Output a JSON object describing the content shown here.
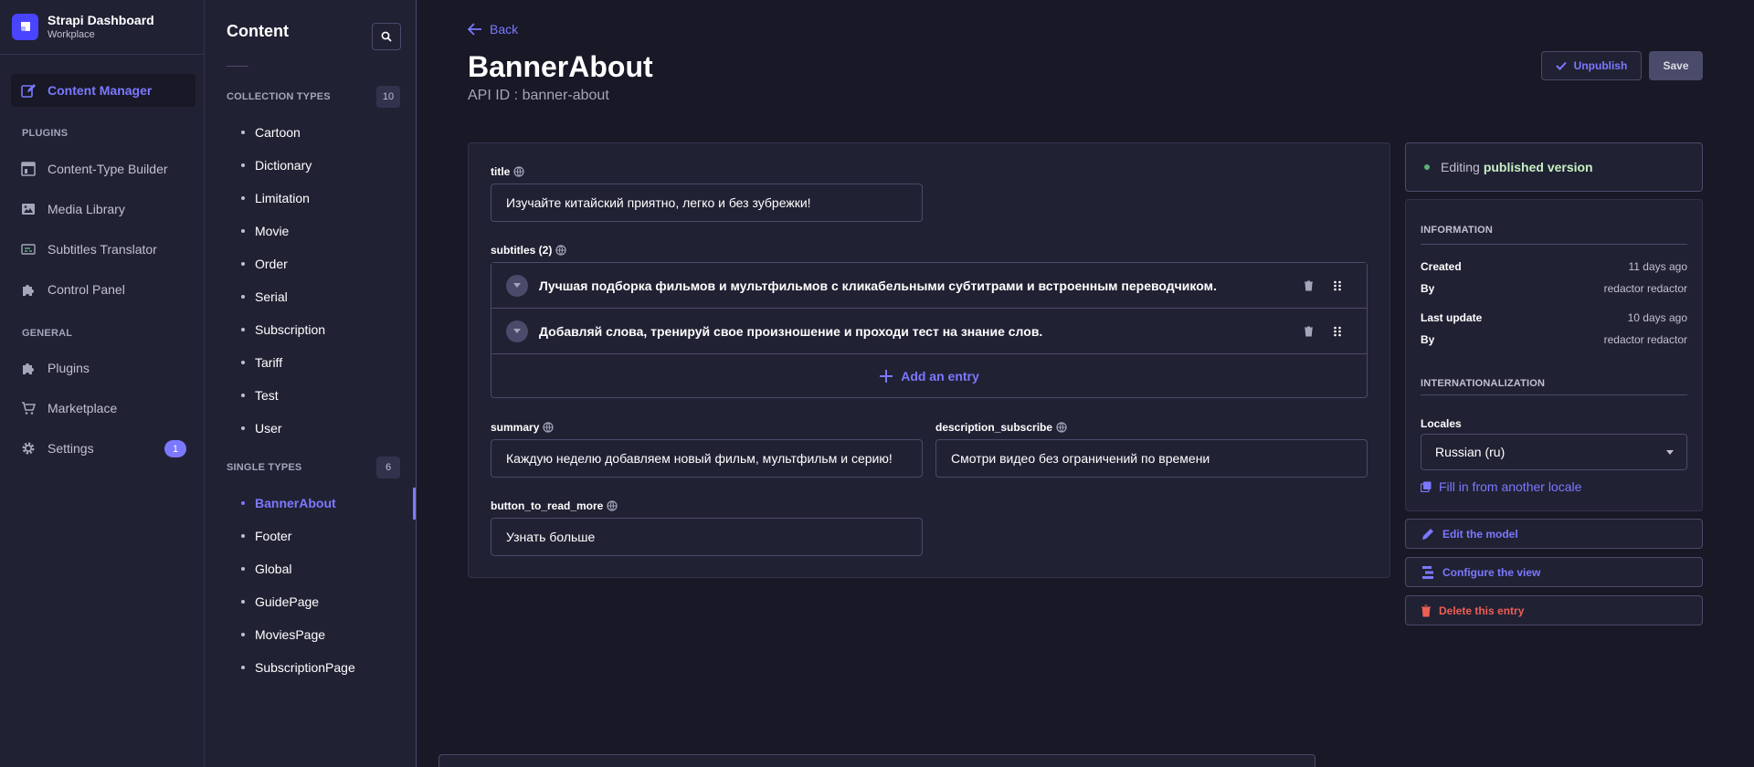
{
  "brand": {
    "title": "Strapi Dashboard",
    "subtitle": "Workplace"
  },
  "leftnav": {
    "active_item": "Content Manager",
    "section_plugins": "PLUGINS",
    "plugins": [
      "Content-Type Builder",
      "Media Library",
      "Subtitles Translator",
      "Control Panel"
    ],
    "section_general": "GENERAL",
    "general": [
      "Plugins",
      "Marketplace",
      "Settings"
    ],
    "settings_badge": "1"
  },
  "subnav": {
    "title": "Content",
    "collection_label": "COLLECTION TYPES",
    "collection_count": "10",
    "collection_types": [
      "Cartoon",
      "Dictionary",
      "Limitation",
      "Movie",
      "Order",
      "Serial",
      "Subscription",
      "Tariff",
      "Test",
      "User"
    ],
    "single_label": "SINGLE TYPES",
    "single_count": "6",
    "single_types": [
      "BannerAbout",
      "Footer",
      "Global",
      "GuidePage",
      "MoviesPage",
      "SubscriptionPage"
    ]
  },
  "header": {
    "back": "Back",
    "title": "BannerAbout",
    "api_id": "API ID : banner-about",
    "unpublish": "Unpublish",
    "save": "Save"
  },
  "form": {
    "title_label": "title",
    "title_value": "Изучайте китайский приятно, легко и без зубрежки!",
    "subtitles_label": "subtitles (2)",
    "subtitles": [
      "Лучшая подборка фильмов и мультфильмов с кликабельными субтитрами и встроенным переводчиком.",
      "Добавляй слова, тренируй свое произношение и проходи тест на знание слов."
    ],
    "add_entry": "Add an entry",
    "summary_label": "summary",
    "summary_value": "Каждую неделю добавляем новый фильм, мультфильм и серию!",
    "description_subscribe_label": "description_subscribe",
    "description_subscribe_value": "Смотри видео без ограничений по времени",
    "button_to_read_more_label": "button_to_read_more",
    "button_to_read_more_value": "Узнать больше"
  },
  "status": {
    "prefix": "Editing",
    "strong": "published version"
  },
  "information": {
    "heading": "INFORMATION",
    "created_label": "Created",
    "created_value": "11 days ago",
    "by_label": "By",
    "created_by": "redactor redactor",
    "updated_label": "Last update",
    "updated_value": "10 days ago",
    "updated_by": "redactor redactor",
    "i18n_heading": "INTERNATIONALIZATION",
    "locales_label": "Locales",
    "locale_value": "Russian (ru)",
    "fill_link": "Fill in from another locale"
  },
  "actions": {
    "edit_model": "Edit the model",
    "configure_view": "Configure the view",
    "delete_entry": "Delete this entry"
  },
  "colors": {
    "accent": "#7b79ff",
    "background": "#181826",
    "panel": "#212134",
    "border": "#4a4a6a",
    "success": "#5cb176",
    "danger": "#ee5e52"
  }
}
